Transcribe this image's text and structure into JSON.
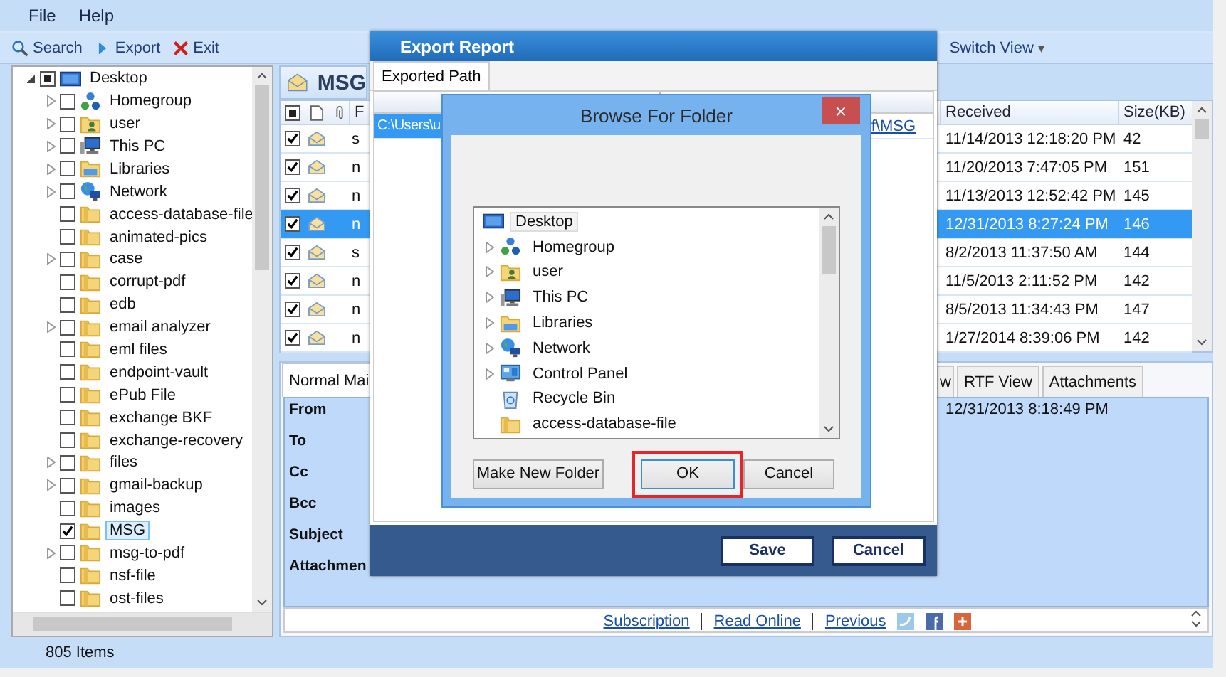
{
  "menu": [
    "File",
    "Help"
  ],
  "toolbar": [
    {
      "kind": "search",
      "label": "Search"
    },
    {
      "kind": "export",
      "label": "Export"
    },
    {
      "kind": "exit",
      "label": "Exit"
    }
  ],
  "switch_view": {
    "label": "Switch View",
    "caret": "▾"
  },
  "folder_tree": {
    "label": "Desktop",
    "kind": "computer",
    "expanded": true,
    "partial": true,
    "children": [
      {
        "label": "Homegroup",
        "kind": "homegroup",
        "expandable": true,
        "checked": false,
        "selected": false
      },
      {
        "label": "user",
        "kind": "user",
        "expandable": true,
        "checked": false,
        "selected": false
      },
      {
        "label": "This PC",
        "kind": "pc",
        "expandable": true,
        "checked": false,
        "selected": false
      },
      {
        "label": "Libraries",
        "kind": "libraries",
        "expandable": true,
        "checked": false,
        "selected": false
      },
      {
        "label": "Network",
        "kind": "network",
        "expandable": true,
        "checked": false,
        "selected": false
      },
      {
        "label": "access-database-file",
        "kind": "folder",
        "expandable": false,
        "checked": false,
        "selected": false
      },
      {
        "label": "animated-pics",
        "kind": "folder",
        "expandable": false,
        "checked": false,
        "selected": false
      },
      {
        "label": "case",
        "kind": "folder",
        "expandable": true,
        "checked": false,
        "selected": false
      },
      {
        "label": "corrupt-pdf",
        "kind": "folder",
        "expandable": false,
        "checked": false,
        "selected": false
      },
      {
        "label": "edb",
        "kind": "folder",
        "expandable": false,
        "checked": false,
        "selected": false
      },
      {
        "label": "email analyzer",
        "kind": "folder",
        "expandable": true,
        "checked": false,
        "selected": false
      },
      {
        "label": "eml files",
        "kind": "folder",
        "expandable": false,
        "checked": false,
        "selected": false
      },
      {
        "label": "endpoint-vault",
        "kind": "folder",
        "expandable": false,
        "checked": false,
        "selected": false
      },
      {
        "label": "ePub File",
        "kind": "folder",
        "expandable": false,
        "checked": false,
        "selected": false
      },
      {
        "label": "exchange BKF",
        "kind": "folder",
        "expandable": false,
        "checked": false,
        "selected": false
      },
      {
        "label": "exchange-recovery",
        "kind": "folder",
        "expandable": false,
        "checked": false,
        "selected": false
      },
      {
        "label": "files",
        "kind": "folder",
        "expandable": true,
        "checked": false,
        "selected": false
      },
      {
        "label": "gmail-backup",
        "kind": "folder",
        "expandable": true,
        "checked": false,
        "selected": false
      },
      {
        "label": "images",
        "kind": "folder",
        "expandable": false,
        "checked": false,
        "selected": false
      },
      {
        "label": "MSG",
        "kind": "folder",
        "expandable": false,
        "checked": true,
        "selected": true
      },
      {
        "label": "msg-to-pdf",
        "kind": "folder",
        "expandable": true,
        "checked": false,
        "selected": false
      },
      {
        "label": "nsf-file",
        "kind": "folder",
        "expandable": false,
        "checked": false,
        "selected": false
      },
      {
        "label": "ost-files",
        "kind": "folder",
        "expandable": false,
        "checked": false,
        "selected": false
      }
    ]
  },
  "message_list": {
    "title": "MSG",
    "header_partial": true,
    "columns": [
      "F",
      "Received",
      "Size(KB)"
    ],
    "rows": [
      {
        "checked": true,
        "selected": false,
        "from": "s",
        "received": "11/14/2013 12:18:20 PM",
        "size": "42"
      },
      {
        "checked": true,
        "selected": false,
        "from": "n",
        "received": "11/20/2013 7:47:05 PM",
        "size": "151"
      },
      {
        "checked": true,
        "selected": false,
        "from": "n",
        "received": "11/13/2013 12:52:42 PM",
        "size": "145"
      },
      {
        "checked": true,
        "selected": true,
        "from": "n",
        "received": "12/31/2013 8:27:24 PM",
        "size": "146"
      },
      {
        "checked": true,
        "selected": false,
        "from": "s",
        "received": "8/2/2013 11:37:50 AM",
        "size": "144"
      },
      {
        "checked": true,
        "selected": false,
        "from": "n",
        "received": "11/5/2013 2:11:52 PM",
        "size": "142"
      },
      {
        "checked": true,
        "selected": false,
        "from": "n",
        "received": "8/5/2013 11:34:43 PM",
        "size": "147"
      },
      {
        "checked": true,
        "selected": false,
        "from": "n",
        "received": "1/27/2014 8:39:06 PM",
        "size": "142"
      }
    ]
  },
  "preview": {
    "tabs": [
      {
        "label": "Normal Mai",
        "selected": true
      },
      {
        "label": "w",
        "selected": false
      },
      {
        "label": "RTF View",
        "selected": false
      },
      {
        "label": "Attachments",
        "selected": false
      }
    ],
    "fields": [
      "From",
      "To",
      "Cc",
      "Bcc",
      "Subject",
      "Attachmen"
    ],
    "date": "12/31/2013 8:18:49 PM",
    "links": [
      "Subscription",
      "Read Online",
      "Previous"
    ]
  },
  "status_bar": "805 Items",
  "export_dialog": {
    "title": "Export Report",
    "tabs": [
      {
        "label": "Exported Path",
        "selected": true
      }
    ],
    "path_start": "C:\\Users\\u",
    "path_end": "f\\MSG",
    "buttons": [
      "Save",
      "Cancel"
    ]
  },
  "browse_dialog": {
    "title": "Browse For Folder",
    "close": "×",
    "tree": {
      "label": "Desktop",
      "kind": "computer",
      "selected": true,
      "children": [
        {
          "label": "Homegroup",
          "kind": "homegroup",
          "expandable": true,
          "selected": false
        },
        {
          "label": "user",
          "kind": "user",
          "expandable": true,
          "selected": false
        },
        {
          "label": "This PC",
          "kind": "pc",
          "expandable": true,
          "selected": false
        },
        {
          "label": "Libraries",
          "kind": "libraries",
          "expandable": true,
          "selected": false
        },
        {
          "label": "Network",
          "kind": "network",
          "expandable": true,
          "selected": false
        },
        {
          "label": "Control Panel",
          "kind": "control-panel",
          "expandable": true,
          "selected": false
        },
        {
          "label": "Recycle Bin",
          "kind": "recycle-bin",
          "expandable": false,
          "selected": false
        },
        {
          "label": "access-database-file",
          "kind": "folder",
          "expandable": false,
          "selected": false
        }
      ]
    },
    "buttons": [
      {
        "label": "Make New Folder",
        "highlighted": false
      },
      {
        "label": "OK",
        "highlighted": true
      },
      {
        "label": "Cancel",
        "highlighted": false
      }
    ]
  }
}
